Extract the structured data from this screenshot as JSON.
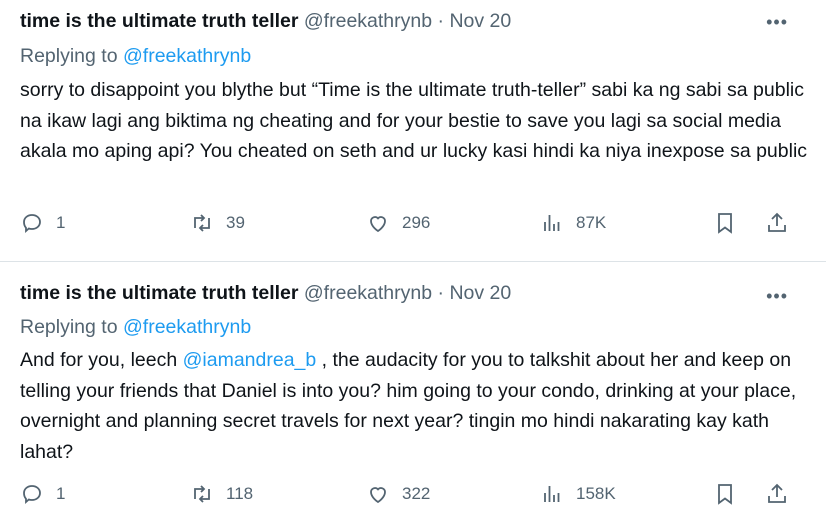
{
  "tweets": [
    {
      "author": "time is the ultimate truth teller",
      "handle": "@freekathrynb",
      "separator": "·",
      "date": "Nov 20",
      "replying_prefix": "Replying to",
      "replying_handle": "@freekathrynb",
      "text": "sorry to disappoint you blythe but “Time is the ultimate truth-teller” sabi ka ng sabi sa public na ikaw lagi ang biktima ng cheating and for your bestie to save you lagi sa social media akala mo aping api? You cheated on seth and ur lucky kasi hindi ka niya inexpose sa public",
      "replies": "1",
      "retweets": "39",
      "likes": "296",
      "views": "87K"
    },
    {
      "author": "time is the ultimate truth teller",
      "handle": "@freekathrynb",
      "separator": "·",
      "date": "Nov 20",
      "replying_prefix": "Replying to",
      "replying_handle": "@freekathrynb",
      "text_before": "And for you, leech ",
      "mention": "@iamandrea_b",
      "text_after": " , the audacity for you to talkshit about her and keep on telling your friends that Daniel is into you? him going to your condo, drinking at your place, overnight and planning secret travels for next year? tingin mo hindi nakarating kay kath lahat?",
      "replies": "1",
      "retweets": "118",
      "likes": "322",
      "views": "158K"
    }
  ],
  "icons": {
    "more": "more-icon",
    "reply": "reply-icon",
    "retweet": "retweet-icon",
    "like": "heart-icon",
    "views": "views-icon",
    "bookmark": "bookmark-icon",
    "share": "share-icon"
  },
  "more_glyph": "•••",
  "colors": {
    "link": "#1d9bf0",
    "muted": "#536471",
    "text": "#0f1419",
    "divider": "#dde3e7"
  }
}
